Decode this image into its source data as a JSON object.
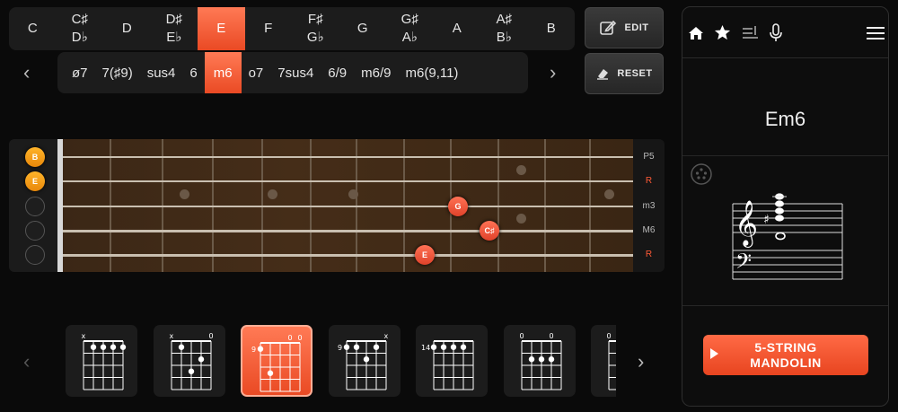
{
  "keys": [
    {
      "top": "C"
    },
    {
      "top": "C♯",
      "bottom": "D♭"
    },
    {
      "top": "D"
    },
    {
      "top": "D♯",
      "bottom": "E♭"
    },
    {
      "top": "E",
      "active": true
    },
    {
      "top": "F"
    },
    {
      "top": "F♯",
      "bottom": "G♭"
    },
    {
      "top": "G"
    },
    {
      "top": "G♯",
      "bottom": "A♭"
    },
    {
      "top": "A"
    },
    {
      "top": "A♯",
      "bottom": "B♭"
    },
    {
      "top": "B"
    }
  ],
  "toolbar": {
    "edit_label": "EDIT",
    "reset_label": "RESET"
  },
  "chord_types": [
    "ø7",
    "7(♯9)",
    "sus4",
    "6",
    "m6",
    "o7",
    "7sus4",
    "6/9",
    "m6/9",
    "m6(9,11)"
  ],
  "active_chord_type": "m6",
  "fretboard": {
    "intervals": [
      {
        "label": "P5",
        "root": false
      },
      {
        "label": "R",
        "root": true
      },
      {
        "label": "m3",
        "root": false
      },
      {
        "label": "M6",
        "root": false
      },
      {
        "label": "R",
        "root": true
      }
    ],
    "open_notes": [
      "B",
      "E",
      "",
      "",
      ""
    ],
    "fretted_notes": [
      {
        "label": "G",
        "string": 3,
        "fret": 11
      },
      {
        "label": "C♯",
        "string": 4,
        "fret": 12
      },
      {
        "label": "E",
        "string": 5,
        "fret": 10
      }
    ],
    "inlays": [
      {
        "fret": 3,
        "string_gap": 2.5
      },
      {
        "fret": 5,
        "string_gap": 2.5
      },
      {
        "fret": 7,
        "string_gap": 2.5
      },
      {
        "fret": 12,
        "string_gap": 1.5
      },
      {
        "fret": 12,
        "string_gap": 3.5
      },
      {
        "fret": 15,
        "string_gap": 2.5
      }
    ]
  },
  "diagrams": [
    {
      "top_labels": [
        "x",
        "",
        "",
        "",
        ""
      ],
      "fret_label": "",
      "dots": [
        [
          2,
          1
        ],
        [
          3,
          1
        ],
        [
          4,
          1
        ],
        [
          5,
          1
        ]
      ],
      "active": false
    },
    {
      "top_labels": [
        "x",
        "",
        "",
        "",
        "0"
      ],
      "fret_label": "",
      "dots": [
        [
          2,
          1
        ],
        [
          3,
          3
        ],
        [
          4,
          2
        ]
      ],
      "active": false
    },
    {
      "top_labels": [
        "",
        "",
        "",
        "0",
        "0"
      ],
      "fret_label": "9",
      "dots": [
        [
          1,
          1
        ],
        [
          2,
          3
        ]
      ],
      "active": true
    },
    {
      "top_labels": [
        "",
        "",
        "",
        "",
        "x"
      ],
      "fret_label": "9",
      "dots": [
        [
          1,
          1
        ],
        [
          2,
          1
        ],
        [
          3,
          2
        ],
        [
          4,
          1
        ]
      ],
      "active": false
    },
    {
      "top_labels": [
        "",
        "",
        "",
        "",
        ""
      ],
      "fret_label": "14",
      "dots": [
        [
          1,
          1
        ],
        [
          2,
          1
        ],
        [
          3,
          1
        ],
        [
          4,
          1
        ]
      ],
      "active": false
    },
    {
      "top_labels": [
        "0",
        "",
        "",
        "0",
        ""
      ],
      "fret_label": "",
      "dots": [
        [
          2,
          2
        ],
        [
          3,
          2
        ],
        [
          4,
          2
        ]
      ],
      "active": false
    },
    {
      "top_labels": [
        "0",
        "",
        "",
        "",
        ""
      ],
      "fret_label": "",
      "dots": [],
      "active": false
    }
  ],
  "panel": {
    "icons": [
      "home-icon",
      "star-icon",
      "playlist-add-icon",
      "microphone-icon",
      "menu-icon"
    ],
    "chord_name": "Em6",
    "play_label_line1": "5-STRING",
    "play_label_line2": "MANDOLIN"
  },
  "colors": {
    "accent": "#ee5128",
    "open_note": "#f49a14",
    "background": "#0a0a0a"
  }
}
